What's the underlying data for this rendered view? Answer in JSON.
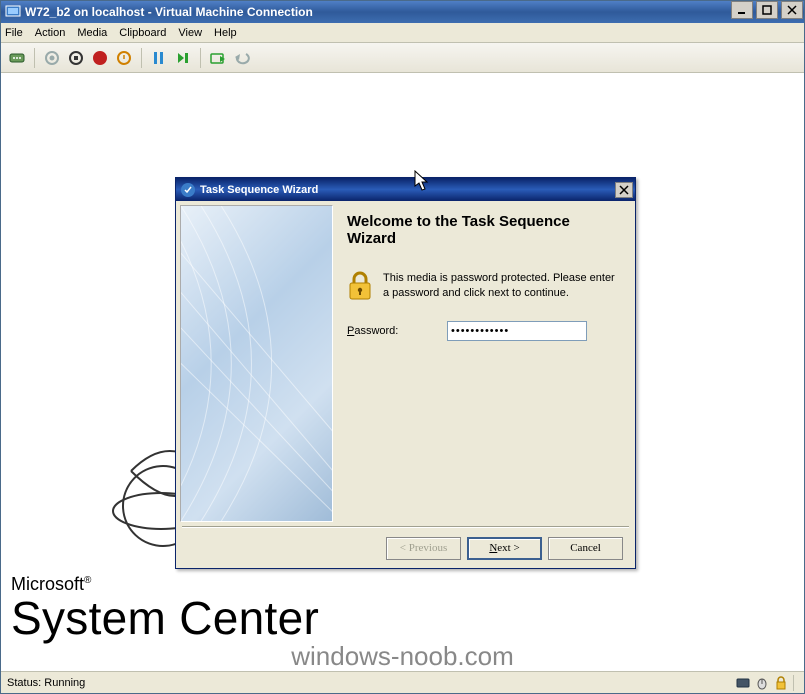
{
  "window": {
    "title": "W72_b2 on localhost - Virtual Machine Connection"
  },
  "menu": {
    "file": "File",
    "action": "Action",
    "media": "Media",
    "clipboard": "Clipboard",
    "view": "View",
    "help": "Help"
  },
  "toolbar_icons": {
    "ctrlaltdel": "ctrl-alt-del-icon",
    "start": "start-icon",
    "turnoff": "turnoff-icon",
    "shutdown": "shutdown-icon",
    "save": "save-icon",
    "pause": "pause-icon",
    "reset": "reset-icon",
    "snapshot": "snapshot-icon",
    "revert": "revert-icon"
  },
  "branding": {
    "microsoft": "Microsoft",
    "reg": "®",
    "product": "System Center"
  },
  "wizard": {
    "title": "Task Sequence Wizard",
    "heading": "Welcome to the Task Sequence Wizard",
    "message": "This media is password protected.  Please enter a password and click next to continue.",
    "password_label_pre": "P",
    "password_label_rest": "assword:",
    "password_value": "************",
    "buttons": {
      "previous": "< Previous",
      "next": "Next >",
      "cancel": "Cancel"
    }
  },
  "statusbar": {
    "status": "Status: Running"
  },
  "watermark": "windows-noob.com"
}
